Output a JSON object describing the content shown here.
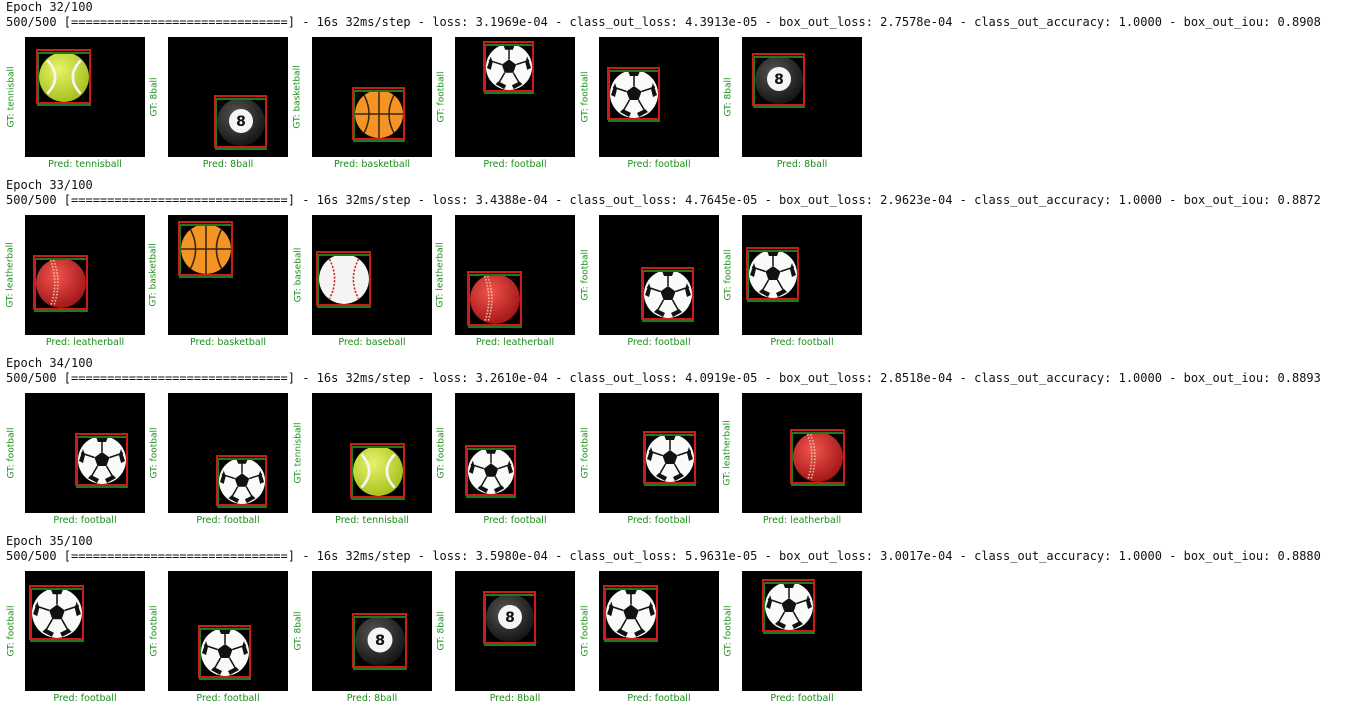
{
  "epochs": [
    {
      "epoch": "Epoch 32/100",
      "progress": "500/500 [==============================] - 16s 32ms/step - loss: 3.1969e-04 - class_out_loss: 4.3913e-05 - box_out_loss: 2.7578e-04 - class_out_accuracy: 1.0000 - box_out_iou: 0.8908",
      "samples": [
        {
          "gt": "GT: tennisball",
          "pred": "Pred: tennisball",
          "ball": "tennisball"
        },
        {
          "gt": "GT: 8ball",
          "pred": "Pred: 8ball",
          "ball": "8ball"
        },
        {
          "gt": "GT: basketball",
          "pred": "Pred: basketball",
          "ball": "basketball"
        },
        {
          "gt": "GT: football",
          "pred": "Pred: football",
          "ball": "football"
        },
        {
          "gt": "GT: football",
          "pred": "Pred: football",
          "ball": "football"
        },
        {
          "gt": "GT: 8ball",
          "pred": "Pred: 8ball",
          "ball": "8ball"
        }
      ]
    },
    {
      "epoch": "Epoch 33/100",
      "progress": "500/500 [==============================] - 16s 32ms/step - loss: 3.4388e-04 - class_out_loss: 4.7645e-05 - box_out_loss: 2.9623e-04 - class_out_accuracy: 1.0000 - box_out_iou: 0.8872",
      "samples": [
        {
          "gt": "GT: leatherball",
          "pred": "Pred: leatherball",
          "ball": "leatherball"
        },
        {
          "gt": "GT: basketball",
          "pred": "Pred: basketball",
          "ball": "basketball"
        },
        {
          "gt": "GT: baseball",
          "pred": "Pred: baseball",
          "ball": "baseball"
        },
        {
          "gt": "GT: leatherball",
          "pred": "Pred: leatherball",
          "ball": "leatherball"
        },
        {
          "gt": "GT: football",
          "pred": "Pred: football",
          "ball": "football"
        },
        {
          "gt": "GT: football",
          "pred": "Pred: football",
          "ball": "football"
        }
      ]
    },
    {
      "epoch": "Epoch 34/100",
      "progress": "500/500 [==============================] - 16s 32ms/step - loss: 3.2610e-04 - class_out_loss: 4.0919e-05 - box_out_loss: 2.8518e-04 - class_out_accuracy: 1.0000 - box_out_iou: 0.8893",
      "samples": [
        {
          "gt": "GT: football",
          "pred": "Pred: football",
          "ball": "football"
        },
        {
          "gt": "GT: football",
          "pred": "Pred: football",
          "ball": "football"
        },
        {
          "gt": "GT: tennisball",
          "pred": "Pred: tennisball",
          "ball": "tennisball"
        },
        {
          "gt": "GT: football",
          "pred": "Pred: football",
          "ball": "football"
        },
        {
          "gt": "GT: football",
          "pred": "Pred: football",
          "ball": "football"
        },
        {
          "gt": "GT: leatherball",
          "pred": "Pred: leatherball",
          "ball": "leatherball"
        }
      ]
    },
    {
      "epoch": "Epoch 35/100",
      "progress": "500/500 [==============================] - 16s 32ms/step - loss: 3.5980e-04 - class_out_loss: 5.9631e-05 - box_out_loss: 3.0017e-04 - class_out_accuracy: 1.0000 - box_out_iou: 0.8880",
      "samples": [
        {
          "gt": "GT: football",
          "pred": "Pred: football",
          "ball": "football"
        },
        {
          "gt": "GT: football",
          "pred": "Pred: football",
          "ball": "football"
        },
        {
          "gt": "GT: 8ball",
          "pred": "Pred: 8ball",
          "ball": "8ball"
        },
        {
          "gt": "GT: 8ball",
          "pred": "Pred: 8ball",
          "ball": "8ball"
        },
        {
          "gt": "GT: football",
          "pred": "Pred: football",
          "ball": "football"
        },
        {
          "gt": "GT: football",
          "pred": "Pred: football",
          "ball": "football"
        }
      ]
    }
  ],
  "colors": {
    "gt_box": "#1e7a1e",
    "pred_box": "#d01a1a",
    "label_text": "#1a8f1a",
    "image_bg": "#000000"
  }
}
